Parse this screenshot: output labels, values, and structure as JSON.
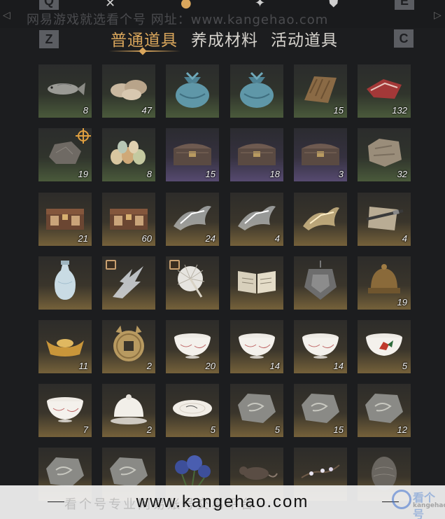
{
  "watermark_top": "网易游戏就选看个号   网址：www.kangehao.com",
  "keys": {
    "prev_top": "Q",
    "next_top": "E",
    "prev_tab": "Z",
    "next_tab": "C"
  },
  "tabs": [
    {
      "label": "普通道具",
      "active": true
    },
    {
      "label": "养成材料",
      "active": false
    },
    {
      "label": "活动道具",
      "active": false
    }
  ],
  "colors": {
    "accent": "#d9a65c",
    "background": "#1c1d1f"
  },
  "grid": [
    [
      {
        "icon": "fish-icon",
        "quality": "green",
        "count": "8"
      },
      {
        "icon": "oyster-icon",
        "quality": "green",
        "count": "47"
      },
      {
        "icon": "cloth-pouch-icon",
        "quality": "green",
        "count": ""
      },
      {
        "icon": "cloth-pouch-icon",
        "quality": "green",
        "count": ""
      },
      {
        "icon": "fur-pelt-icon",
        "quality": "green",
        "count": "15"
      },
      {
        "icon": "raw-meat-icon",
        "quality": "green",
        "count": "132"
      }
    ],
    [
      {
        "icon": "ore-rock-icon",
        "quality": "green",
        "count": "19",
        "tracked": true
      },
      {
        "icon": "eggs-icon",
        "quality": "green",
        "count": "8"
      },
      {
        "icon": "treasure-chest-icon",
        "quality": "purple",
        "count": "15"
      },
      {
        "icon": "treasure-chest-icon",
        "quality": "purple",
        "count": "18"
      },
      {
        "icon": "treasure-chest-icon",
        "quality": "purple",
        "count": "3"
      },
      {
        "icon": "animal-hide-icon",
        "quality": "green",
        "count": "32"
      }
    ],
    [
      {
        "icon": "ornate-chest-icon",
        "quality": "gold",
        "count": "21"
      },
      {
        "icon": "ornate-chest-icon",
        "quality": "gold",
        "count": "60"
      },
      {
        "icon": "spirit-crystal-icon",
        "quality": "gold",
        "count": "24"
      },
      {
        "icon": "spirit-crystal-icon",
        "quality": "gold",
        "count": "4"
      },
      {
        "icon": "golden-spirit-icon",
        "quality": "gold",
        "count": ""
      },
      {
        "icon": "scroll-sword-icon",
        "quality": "gold",
        "count": "4"
      }
    ],
    [
      {
        "icon": "porcelain-vase-icon",
        "quality": "gold",
        "count": ""
      },
      {
        "icon": "lightning-spirit-icon",
        "quality": "gold",
        "count": "",
        "tagged": true
      },
      {
        "icon": "feather-fan-icon",
        "quality": "gold",
        "count": "",
        "tagged": true
      },
      {
        "icon": "open-book-icon",
        "quality": "gold",
        "count": ""
      },
      {
        "icon": "hanging-token-icon",
        "quality": "gold",
        "count": ""
      },
      {
        "icon": "bronze-helmet-icon",
        "quality": "gold",
        "count": "19"
      }
    ],
    [
      {
        "icon": "gold-ingot-icon",
        "quality": "gold",
        "count": "11"
      },
      {
        "icon": "square-hole-coin-icon",
        "quality": "gold",
        "count": "2"
      },
      {
        "icon": "porcelain-bowl-icon",
        "quality": "gold",
        "count": "20"
      },
      {
        "icon": "porcelain-bowl-icon",
        "quality": "gold",
        "count": "14"
      },
      {
        "icon": "porcelain-bowl-icon",
        "quality": "gold",
        "count": "14"
      },
      {
        "icon": "rooster-bowl-icon",
        "quality": "gold",
        "count": "5"
      }
    ],
    [
      {
        "icon": "porcelain-bowl-icon",
        "quality": "gold",
        "count": "7"
      },
      {
        "icon": "lidded-bowl-icon",
        "quality": "gold",
        "count": "2"
      },
      {
        "icon": "porcelain-plate-icon",
        "quality": "gold",
        "count": "5"
      },
      {
        "icon": "stone-carving-icon",
        "quality": "gold",
        "count": "5"
      },
      {
        "icon": "stone-carving-icon",
        "quality": "gold",
        "count": "15"
      },
      {
        "icon": "stone-carving-icon",
        "quality": "gold",
        "count": "12"
      }
    ],
    [
      {
        "icon": "stone-carving-icon",
        "quality": "gold",
        "count": ""
      },
      {
        "icon": "stone-carving-icon",
        "quality": "gold",
        "count": ""
      },
      {
        "icon": "blue-flower-icon",
        "quality": "gold",
        "count": ""
      },
      {
        "icon": "rat-icon",
        "quality": "gold",
        "count": ""
      },
      {
        "icon": "plum-branch-icon",
        "quality": "gold",
        "count": ""
      },
      {
        "icon": "dark-egg-icon",
        "quality": "gold",
        "count": ""
      }
    ]
  ],
  "watermark_bottom_faint": "看个号专业网易账号交易平台",
  "watermark_bottom": "www.kangehao.com",
  "logo": {
    "text": "看个号",
    "sub": "kangehao.com"
  }
}
